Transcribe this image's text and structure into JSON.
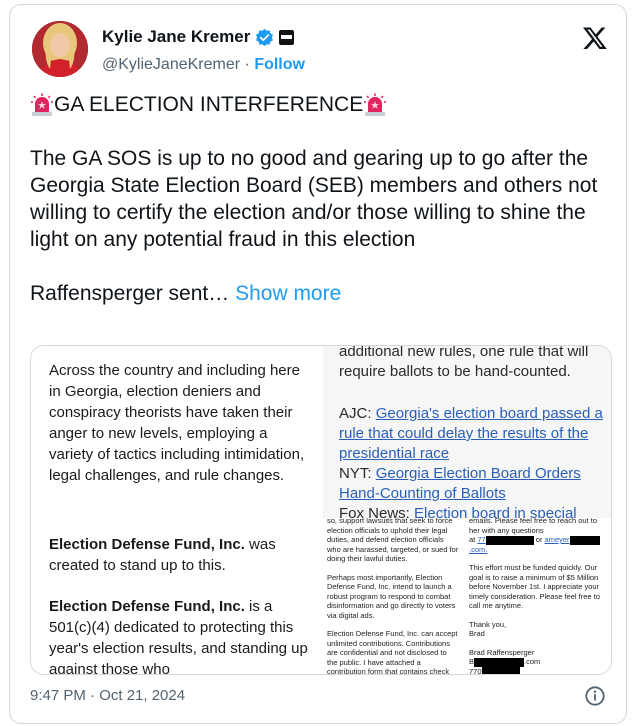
{
  "author": {
    "name": "Kylie Jane Kremer",
    "handle": "@KylieJaneKremer",
    "separator": "·",
    "follow_label": "Follow"
  },
  "icons": {
    "verified": "verified-badge-icon",
    "affiliation": "affiliation-badge-icon",
    "brand": "x-logo-icon",
    "siren": "police-siren-icon",
    "info": "info-icon"
  },
  "colors": {
    "link": "#1d9bf0",
    "text": "#0f1419",
    "muted": "#536471",
    "siren": "#e0245e"
  },
  "tweet": {
    "title": "GA ELECTION INTERFERENCE",
    "body": "The GA SOS is up to no good and gearing up to go after the Georgia State Election Board (SEB) members and others not willing to certify the election and/or those willing to shine the light on any potential fraud in this election",
    "truncated": "Raffensperger sent…",
    "show_more_label": "Show more"
  },
  "media": {
    "left": {
      "p1": "Across the country and including here in Georgia, election deniers and conspiracy theorists have taken their anger to new levels, employing a variety of tactics including intimidation, legal challenges, and rule changes.",
      "p2_bold": "Election Defense Fund, Inc.",
      "p2_rest": " was created to stand up to this.",
      "p3_bold": "Election Defense Fund, Inc.",
      "p3_rest": " is a 501(c)(4) dedicated to protecting this year's election results, and standing up against those who"
    },
    "right_top": {
      "intro": "additional new rules, one rule that will require ballots to be hand-counted.",
      "ajc_label": "AJC: ",
      "ajc_link": "Georgia's election board passed a rule that could delay the results of the presidential race",
      "nyt_label": "NYT: ",
      "nyt_link": "Georgia Election Board Orders Hand-Counting of Ballots",
      "fox_label": "Fox News: ",
      "fox_link": "Election board in special"
    },
    "doc_left": {
      "p1": "so, support lawsuits that seek to force election officials to uphold their legal duties, and defend election officials who are harassed, targeted, or sued for doing their lawful duties.",
      "p2": "Perhaps most importantly, Election Defense Fund, Inc. intend to launch a robust program to respond to combat disinformation and go directly to voters via digital ads.",
      "p3": "Election Defense Fund, Inc. can accept unlimited contributions. Contributions are confidential and not disclosed to the public. I have attached a contribution form that contains check and wire instructions. You can also make a contribution"
    },
    "doc_right": {
      "p1a": "emails. Please feel free to reach out to her with any questions",
      "p1b_at": "at ",
      "p1b_phone": "77",
      "p1b_or": " or ",
      "p1b_email": "ameyer",
      "p1c": ".com.",
      "p2": "This effort must be funded quickly. Our goal is to raise a minimum of $5 Million before November 1st. I appreciate your timely consideration. Please feel free to call me anytime.",
      "p3": "Thank you,",
      "p4": "Brad",
      "p5": "Brad Raffensperger",
      "p6a": "B",
      "p6b": ".com",
      "p7": "770"
    }
  },
  "meta": {
    "time": "9:47 PM · Oct 21, 2024"
  }
}
